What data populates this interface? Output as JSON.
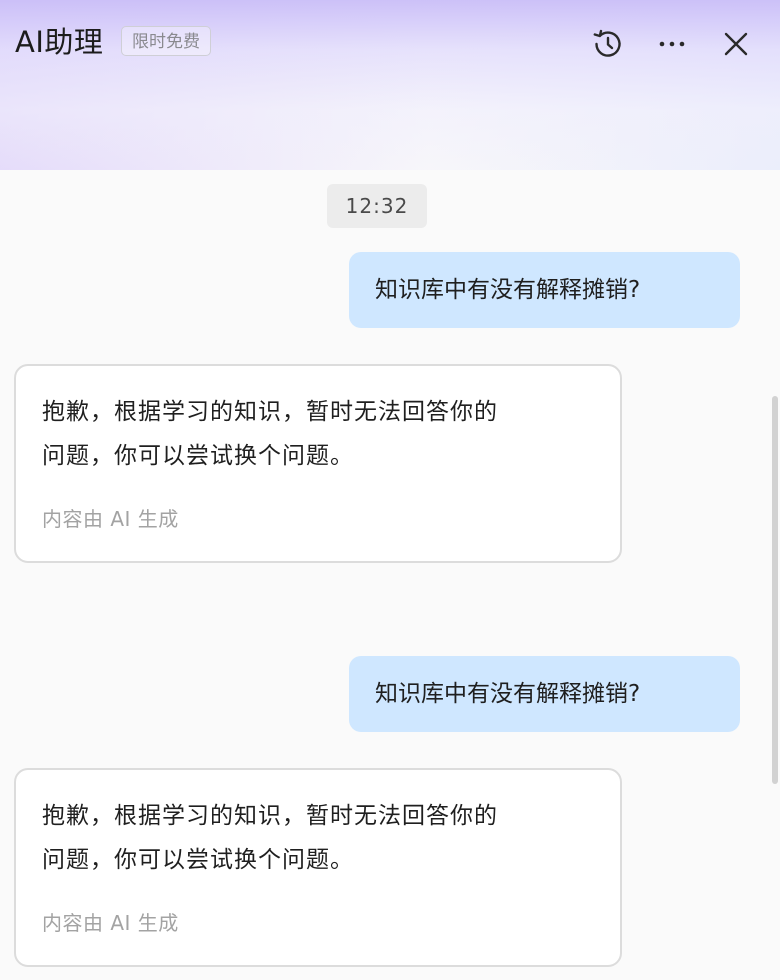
{
  "header": {
    "title": "AI助理",
    "badge": "限时免费",
    "icons": [
      "history-icon",
      "more-icon",
      "close-icon"
    ]
  },
  "chat": {
    "timestamp": "12:32",
    "messages": [
      {
        "role": "user",
        "text": "知识库中有没有解释摊销?"
      },
      {
        "role": "assistant",
        "lines": [
          "抱歉，根据学习的知识，暂时无法回答你的",
          "问题，你可以尝试换个问题。"
        ],
        "note": "内容由 AI 生成"
      },
      {
        "role": "user",
        "text": "知识库中有没有解释摊销?"
      },
      {
        "role": "assistant",
        "lines": [
          "抱歉，根据学习的知识，暂时无法回答你的",
          "问题，你可以尝试换个问题。"
        ],
        "note": "内容由 AI 生成"
      }
    ]
  },
  "colors": {
    "user_bubble": "#cfe7ff",
    "header_gradient_top": "#cabef8",
    "note_text": "#a3a3a3"
  }
}
